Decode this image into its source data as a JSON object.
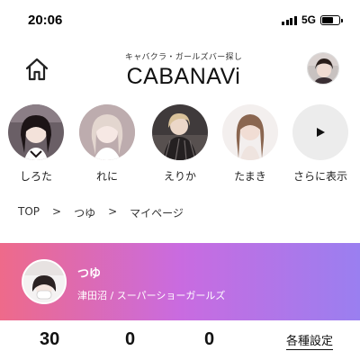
{
  "status": {
    "time": "20:06",
    "network": "5G",
    "battery_level": 0.65
  },
  "header": {
    "logo_subtitle": "キャバクラ・ガールズバー探し",
    "logo_text": "CABANAVi"
  },
  "stories": [
    {
      "name": "しろた"
    },
    {
      "name": "れに"
    },
    {
      "name": "えりか"
    },
    {
      "name": "たまき"
    }
  ],
  "stories_more": {
    "label": "さらに表示",
    "icon": "play-icon"
  },
  "breadcrumb": {
    "items": [
      "TOP",
      "つゆ",
      "マイページ"
    ],
    "separator": ">"
  },
  "profile": {
    "name": "つゆ",
    "subtitle": "津田沼 / スーパーショーガールズ"
  },
  "stats": {
    "values": [
      "30",
      "0",
      "0"
    ]
  },
  "settings_label": "各種設定",
  "colors": {
    "banner_start": "#ee6a8a",
    "banner_mid": "#c96be0",
    "banner_end": "#9a7ff0"
  }
}
